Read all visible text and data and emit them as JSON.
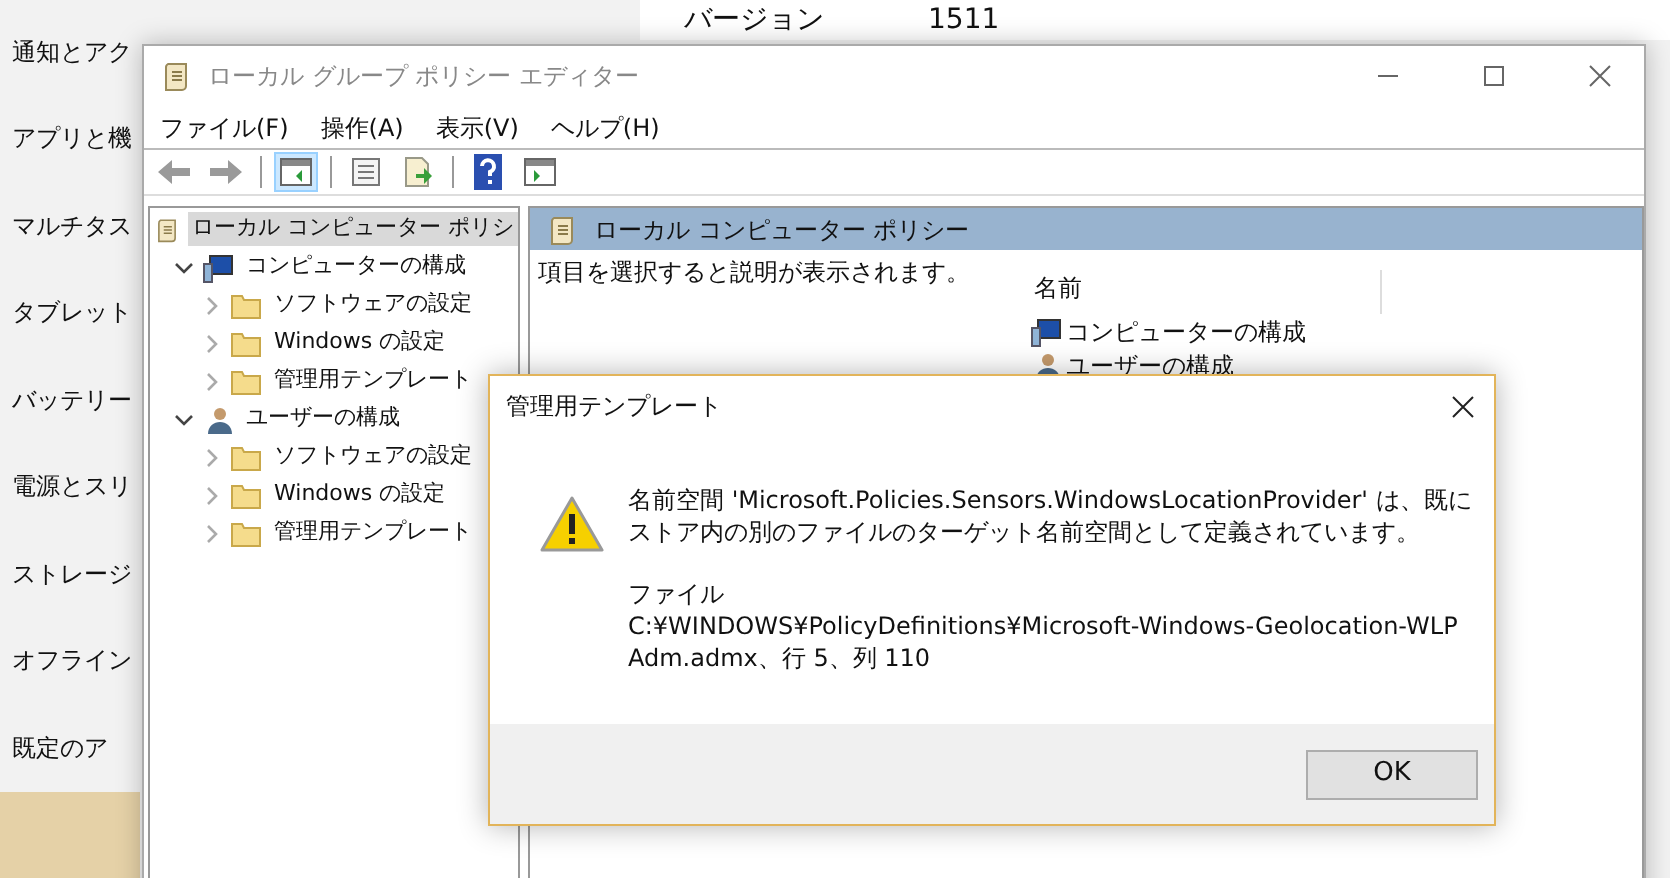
{
  "settings": {
    "nav": [
      {
        "label": "通知とアク",
        "selected": false
      },
      {
        "label": "アプリと機",
        "selected": false
      },
      {
        "label": "マルチタス",
        "selected": false
      },
      {
        "label": "タブレット",
        "selected": false
      },
      {
        "label": "バッテリー",
        "selected": false
      },
      {
        "label": "電源とスリ",
        "selected": false
      },
      {
        "label": "ストレージ",
        "selected": false
      },
      {
        "label": "オフライン",
        "selected": false
      },
      {
        "label": "既定のア",
        "selected": false
      },
      {
        "selected": true
      }
    ],
    "version_label": "バージョン",
    "version_value": "1511"
  },
  "editor": {
    "title": "ローカル グループ ポリシー エディター",
    "menu": [
      "ファイル(F)",
      "操作(A)",
      "表示(V)",
      "ヘルプ(H)"
    ],
    "toolbar": [
      {
        "kind": "back",
        "pressed": false
      },
      {
        "kind": "forward",
        "pressed": false
      },
      {
        "kind": "pane",
        "pressed": true
      },
      {
        "kind": "properties",
        "pressed": false
      },
      {
        "kind": "export",
        "pressed": false
      },
      {
        "kind": "help",
        "pressed": false
      },
      {
        "kind": "view",
        "pressed": false
      }
    ],
    "tree": [
      {
        "label": "ローカル コンピューター ポリシ",
        "kind": "policy",
        "selected": true,
        "children": [
          {
            "label": "コンピューターの構成",
            "kind": "computer",
            "expanded": true,
            "selected": false,
            "children": [
              {
                "label": "ソフトウェアの設定",
                "kind": "folder",
                "expanded": false,
                "selected": false
              },
              {
                "label": "Windows の設定",
                "kind": "folder",
                "expanded": false,
                "selected": false
              },
              {
                "label": "管理用テンプレート",
                "kind": "folder",
                "expanded": false,
                "selected": false
              }
            ]
          },
          {
            "label": "ユーザーの構成",
            "kind": "user",
            "expanded": true,
            "selected": false,
            "children": [
              {
                "label": "ソフトウェアの設定",
                "kind": "folder",
                "expanded": false,
                "selected": false
              },
              {
                "label": "Windows の設定",
                "kind": "folder",
                "expanded": false,
                "selected": false
              },
              {
                "label": "管理用テンプレート",
                "kind": "folder",
                "expanded": false,
                "selected": false
              }
            ]
          }
        ]
      }
    ],
    "detail": {
      "header": "ローカル コンピューター ポリシー",
      "description": "項目を選択すると説明が表示されます。",
      "column": "名前",
      "items": [
        {
          "label": "コンピューターの構成",
          "kind": "computer"
        },
        {
          "label": "ユーザーの構成",
          "kind": "user"
        }
      ]
    }
  },
  "dialog": {
    "title": "管理用テンプレート",
    "message_lines": [
      "名前空間 'Microsoft.Policies.Sensors.WindowsLocationProvider' は、既に",
      "ストア内の別のファイルのターゲット名前空間として定義されています。"
    ],
    "file_lines": [
      "ファイル",
      "C:¥WINDOWS¥PolicyDefinitions¥Microsoft-Windows-Geolocation-WLP",
      "Adm.admx、行 5、列 110"
    ],
    "ok": "OK"
  }
}
